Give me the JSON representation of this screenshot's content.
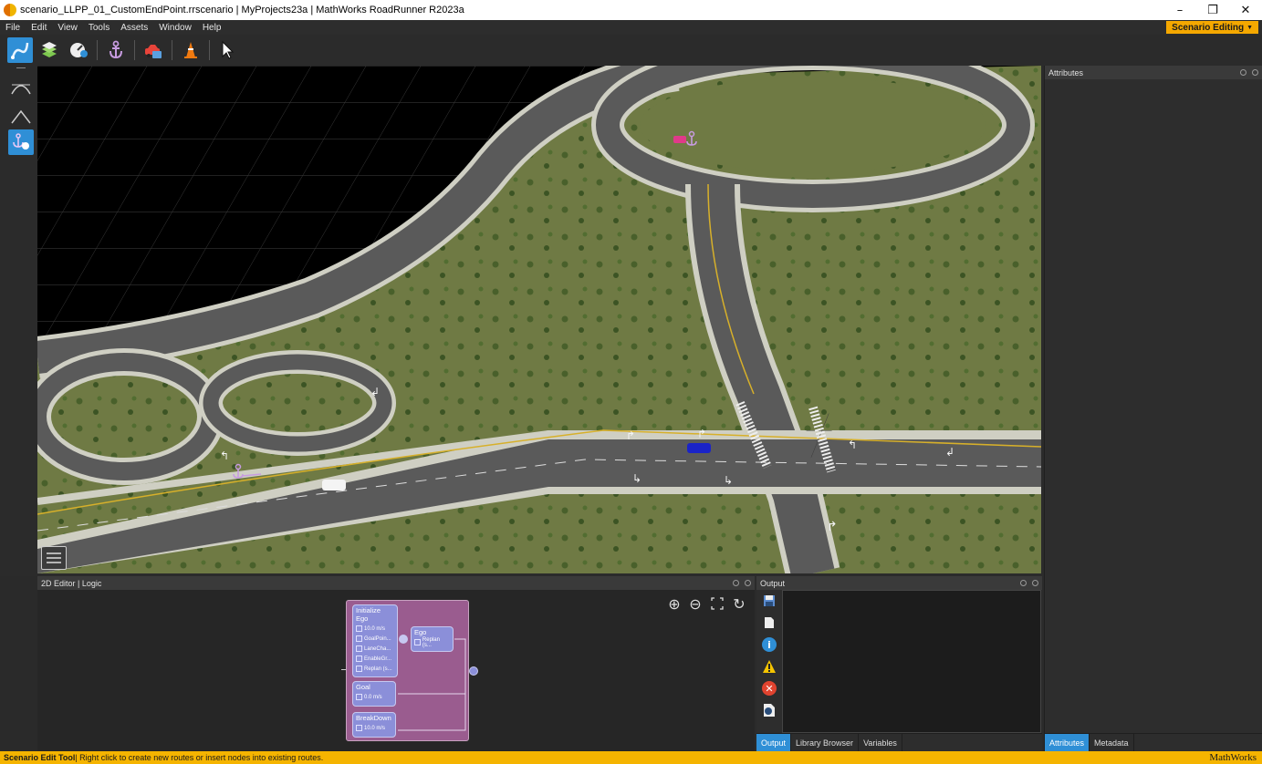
{
  "window": {
    "title": "scenario_LLPP_01_CustomEndPoint.rrscenario | MyProjects23a | MathWorks RoadRunner R2023a",
    "controls": [
      "–",
      "❐",
      "✕"
    ]
  },
  "menu": [
    "File",
    "Edit",
    "View",
    "Tools",
    "Assets",
    "Window",
    "Help"
  ],
  "mode_badge": "Scenario Editing",
  "toolbar": {
    "icons": [
      "path-tool-icon",
      "layers-icon",
      "speed-dial-icon",
      "anchor-icon",
      "vehicle-icon",
      "cone-icon",
      "pointer-icon"
    ]
  },
  "viewport": {
    "road_color": "#5a5a5a",
    "grass_color": "#6f7a44",
    "sidewalk_color": "#cfcfc3"
  },
  "attributes_panel": {
    "title": "Attributes",
    "tabs": [
      "Attributes",
      "Metadata"
    ]
  },
  "editor2d": {
    "title": "2D Editor | Logic",
    "nodes": {
      "init": {
        "title": "Initialize Ego",
        "rows": [
          "10.0 m/s",
          "GoalPoin...",
          "LaneCha...",
          "EnableGr...",
          "Replan (s..."
        ]
      },
      "ego": {
        "title": "Ego",
        "rows": [
          "Replan (s..."
        ]
      },
      "goal": {
        "title": "Goal",
        "rows": [
          "0.0 m/s"
        ]
      },
      "breakdown": {
        "title": "BreakDown",
        "rows": [
          "10.0 m/s"
        ]
      }
    }
  },
  "output_panel": {
    "title": "Output",
    "tabs": [
      "Output",
      "Library Browser",
      "Variables"
    ]
  },
  "status": {
    "tool": "Scenario Edit Tool",
    "message": " | Right click to create new routes or insert nodes into existing routes.",
    "brand": "MathWorks"
  }
}
